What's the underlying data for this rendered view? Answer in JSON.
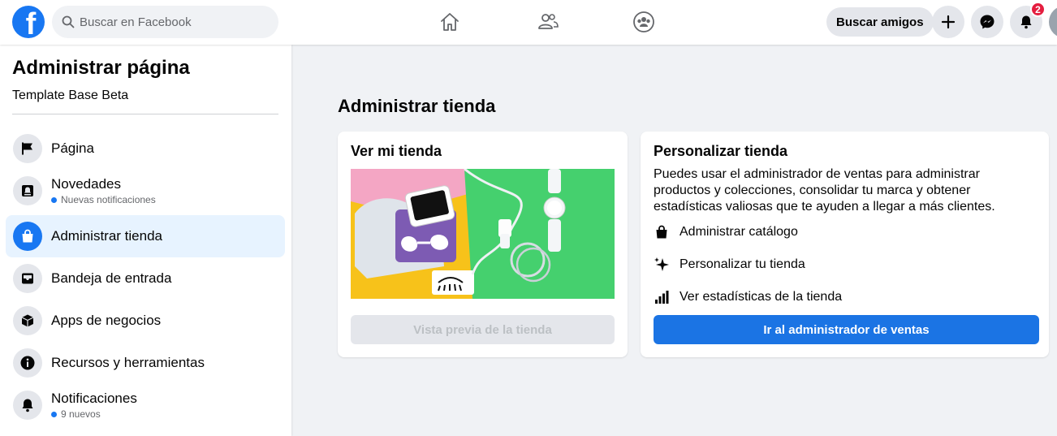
{
  "topbar": {
    "logo_letter": "f",
    "search_placeholder": "Buscar en Facebook",
    "find_friends_label": "Buscar amigos",
    "notification_count": "2",
    "nav_icons": [
      "home-icon",
      "friends-icon",
      "groups-icon"
    ],
    "accent": "#1877f2"
  },
  "sidebar": {
    "title": "Administrar página",
    "page_name": "Template Base Beta",
    "items": [
      {
        "label": "Página",
        "icon": "flag-icon"
      },
      {
        "label": "Novedades",
        "note": "Nuevas notificaciones",
        "icon": "news-bell-icon"
      },
      {
        "label": "Administrar tienda",
        "icon": "shopping-bag-icon",
        "active": true
      },
      {
        "label": "Bandeja de entrada",
        "icon": "inbox-icon"
      },
      {
        "label": "Apps de negocios",
        "icon": "cube-icon"
      },
      {
        "label": "Recursos y herramientas",
        "icon": "info-icon"
      },
      {
        "label": "Notificaciones",
        "note": "9 nuevos",
        "icon": "bell-icon"
      }
    ]
  },
  "main": {
    "title": "Administrar tienda",
    "view_card": {
      "title": "Ver mi tienda",
      "preview_button": "Vista previa de la tienda"
    },
    "customize_card": {
      "title": "Personalizar tienda",
      "description": "Puedes usar el administrador de ventas para administrar productos y colecciones, consolidar tu marca y obtener estadísticas valiosas que te ayuden a llegar a más clientes.",
      "features": [
        {
          "label": "Administrar catálogo",
          "icon": "shopping-bag-icon"
        },
        {
          "label": "Personalizar tu tienda",
          "icon": "sparkle-icon"
        },
        {
          "label": "Ver estadísticas de la tienda",
          "icon": "bar-chart-icon"
        }
      ],
      "primary_button": "Ir al administrador de ventas"
    }
  }
}
